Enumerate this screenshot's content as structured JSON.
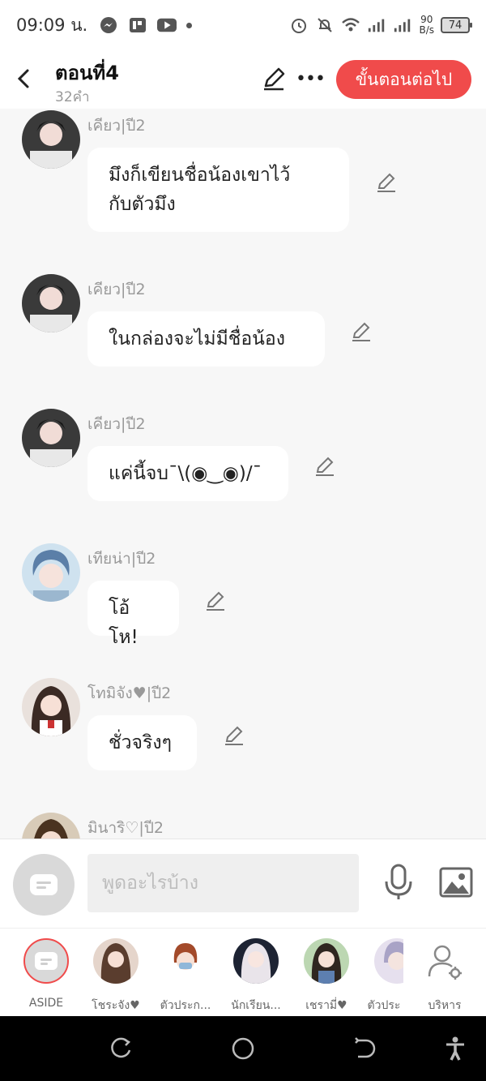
{
  "status": {
    "time": "09:09 น.",
    "netspeed_value": "90",
    "netspeed_unit": "B/s",
    "battery": "74"
  },
  "header": {
    "title": "ตอนที่4",
    "subtitle": "32คำ",
    "next_label": "ขั้นตอนต่อไป"
  },
  "messages": [
    {
      "sender": "เคียว|ปี2",
      "line1": "มึงก็เขียนชื่อน้องเขาไว้",
      "line2": "กับตัวมึง"
    },
    {
      "sender": "เคียว|ปี2",
      "line1": "ในกล่องจะไม่มีชื่อน้อง"
    },
    {
      "sender": "เคียว|ปี2",
      "line1": "แค่นี้จบ¯\\(◉‿◉)/¯"
    },
    {
      "sender": "เทียน่า|ปี2",
      "line1": "โอ้โห!"
    },
    {
      "sender": "โทมิจัง♥|ปี2",
      "line1": "ชั่วจริงๆ"
    },
    {
      "sender": "มินาริ♡|ปี2"
    }
  ],
  "input": {
    "placeholder": "พูดอะไรบ้าง"
  },
  "characters": [
    {
      "name": "ASIDE"
    },
    {
      "name": "โชระจัง♥"
    },
    {
      "name": "ตัวประก..."
    },
    {
      "name": "นักเรียน..."
    },
    {
      "name": "เชรามี่♥"
    },
    {
      "name": "ตัวประ"
    },
    {
      "name": "บริหาร"
    }
  ],
  "colors": {
    "accent": "#f04b4b",
    "bubble": "#ffffff",
    "background": "#f7f7f7"
  }
}
